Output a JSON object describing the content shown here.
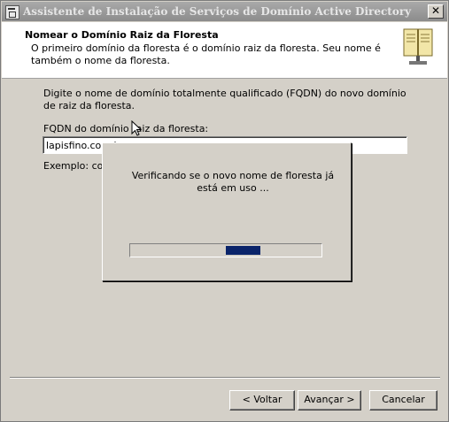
{
  "window": {
    "title": "Assistente de Instalação de Serviços de Domínio Active Directory",
    "close_glyph": "✕"
  },
  "header": {
    "title": "Nomear o Domínio Raiz da Floresta",
    "subtitle": "O primeiro domínio da floresta é o domínio raiz da floresta. Seu nome é também o nome da floresta."
  },
  "content": {
    "instruction": "Digite o nome de domínio totalmente qualificado (FQDN) do novo domínio de raiz da floresta.",
    "fqdn_label": "FQDN do domínio raiz da floresta:",
    "fqdn_value": "lapisfino.com.br",
    "example": "Exemplo: corp"
  },
  "progress_dialog": {
    "message": "Verificando se o novo nome de floresta já está em uso ...",
    "progress": {
      "start": 0.5,
      "end": 0.68
    }
  },
  "buttons": {
    "back": "< Voltar",
    "next": "Avançar >",
    "cancel": "Cancelar"
  },
  "icons": {
    "wizard": "book-icon",
    "cursor": "arrow-cursor-icon"
  },
  "colors": {
    "titlebar": "#9b9b9b",
    "progress_fill": "#0a246a",
    "face": "#d4d0c8"
  }
}
